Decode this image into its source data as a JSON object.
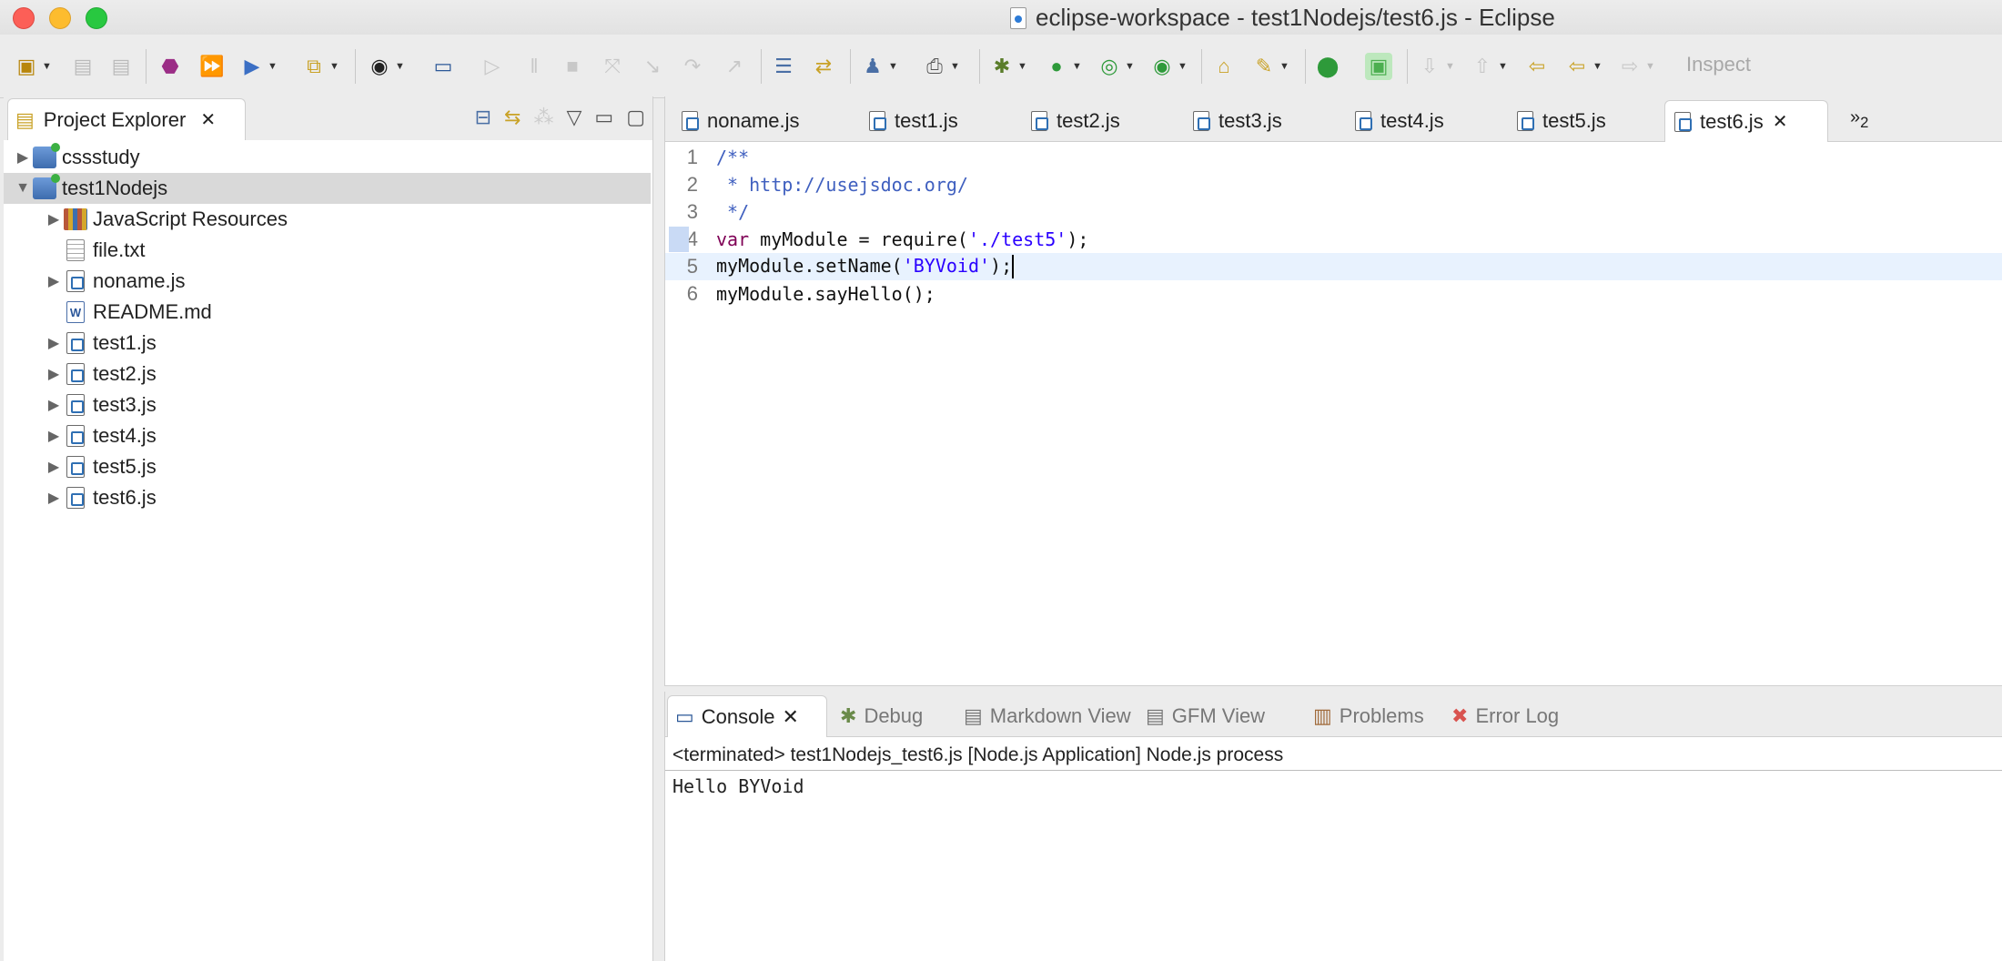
{
  "window": {
    "title": "eclipse-workspace - test1Nodejs/test6.js - Eclipse"
  },
  "toolbar": {
    "inspect_label": "Inspect"
  },
  "project_explorer": {
    "title": "Project Explorer",
    "items": [
      {
        "label": "cssstudy",
        "kind": "project",
        "expanded": false
      },
      {
        "label": "test1Nodejs",
        "kind": "project",
        "expanded": true,
        "selected": true
      },
      {
        "label": "JavaScript Resources",
        "kind": "library"
      },
      {
        "label": "file.txt",
        "kind": "text"
      },
      {
        "label": "noname.js",
        "kind": "js"
      },
      {
        "label": "README.md",
        "kind": "md"
      },
      {
        "label": "test1.js",
        "kind": "js"
      },
      {
        "label": "test2.js",
        "kind": "js"
      },
      {
        "label": "test3.js",
        "kind": "js"
      },
      {
        "label": "test4.js",
        "kind": "js"
      },
      {
        "label": "test5.js",
        "kind": "js"
      },
      {
        "label": "test6.js",
        "kind": "js"
      }
    ]
  },
  "editor": {
    "tabs": [
      "noname.js",
      "test1.js",
      "test2.js",
      "test3.js",
      "test4.js",
      "test5.js",
      "test6.js"
    ],
    "active_tab": "test6.js",
    "overflow_count": "2",
    "lines": [
      {
        "num": "1",
        "text": "/**"
      },
      {
        "num": "2",
        "text": " * http://usejsdoc.org/"
      },
      {
        "num": "3",
        "text": " */"
      },
      {
        "num": "4",
        "text": "var myModule = require('./test5');"
      },
      {
        "num": "5",
        "text": "myModule.setName('BYVoid');"
      },
      {
        "num": "6",
        "text": "myModule.sayHello();"
      }
    ]
  },
  "console": {
    "tabs": [
      "Console",
      "Debug",
      "Markdown View",
      "GFM View",
      "Problems",
      "Error Log"
    ],
    "status": "<terminated> test1Nodejs_test6.js [Node.js Application] Node.js process",
    "output": "Hello BYVoid"
  }
}
